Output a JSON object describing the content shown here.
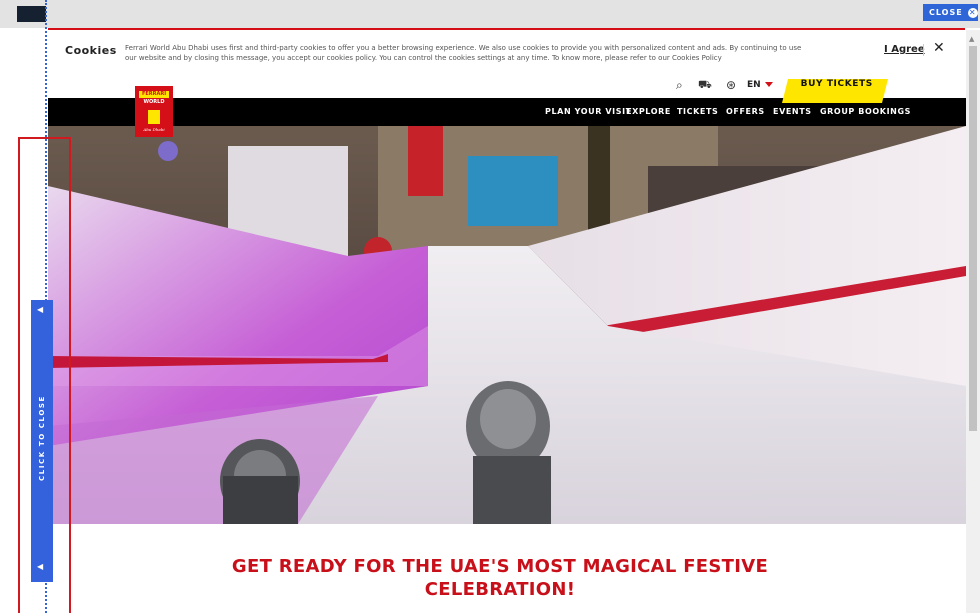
{
  "overlay": {
    "close_label": "CLOSE",
    "side_tab_label": "CLICK TO CLOSE",
    "side_tab_up": "◀",
    "side_tab_down": "◀"
  },
  "cookies": {
    "title": "Cookies",
    "text": "Ferrari World Abu Dhabi uses first and third-party cookies to offer you a better browsing experience. We also use cookies to provide you with personalized content and ads. By continuing to use our website and by closing this message, you accept our cookies policy. You can control the cookies settings at any time. To know more, please refer to our Cookies Policy",
    "agree_label": "I Agree",
    "close_symbol": "✕"
  },
  "header": {
    "search_icon": "⌕",
    "cart_icon": "🛒",
    "account_icon": "⊛",
    "language": "EN",
    "buy_tickets": "BUY TICKETS",
    "logo": {
      "brand_text": "FERRARI",
      "world_text": "WORLD",
      "sub_text": "Abu Dhabi"
    }
  },
  "nav": {
    "items": [
      "PLAN YOUR VISIT",
      "EXPLORE",
      "TICKETS",
      "OFFERS",
      "EVENTS",
      "GROUP BOOKINGS"
    ]
  },
  "hero": {
    "headline_line1": "GET READY FOR THE UAE'S MOST MAGICAL FESTIVE",
    "headline_line2": "CELEBRATION!"
  },
  "colors": {
    "brand_red": "#d40f17",
    "accent_yellow": "#ffe600",
    "overlay_blue": "#3461dc"
  }
}
